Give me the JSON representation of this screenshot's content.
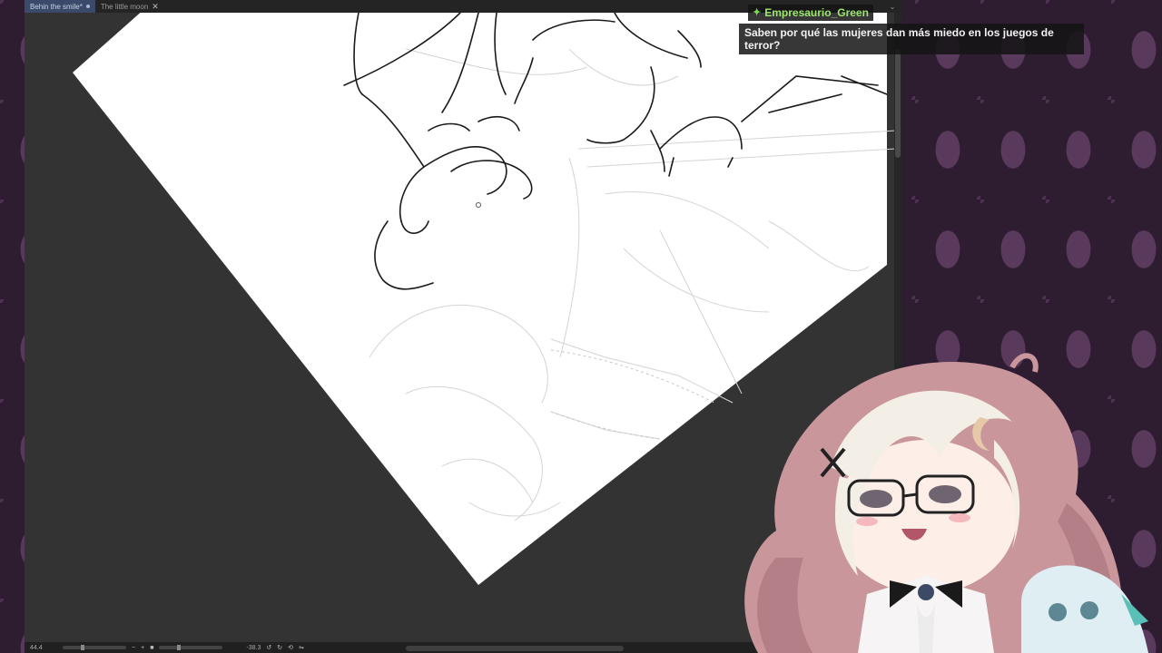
{
  "tabs": [
    {
      "label": "Behin the smile*",
      "active": true,
      "modified": true
    },
    {
      "label": "The little moon",
      "active": false,
      "closable": true
    }
  ],
  "tab_overflow_icon": "chevron-down-icon",
  "status": {
    "zoom": "44.4",
    "angle": "-38.3"
  },
  "chat": {
    "badge_icon": "star-icon",
    "username": "Empresaurio_Green",
    "message": "Saben por qué las mujeres dan más miedo en los juegos de terror?"
  },
  "colors": {
    "tab_active": "#3b4a6b",
    "canvas_bg": "#333333",
    "chat_username": "#9be86b",
    "background": "#2e1c31"
  }
}
